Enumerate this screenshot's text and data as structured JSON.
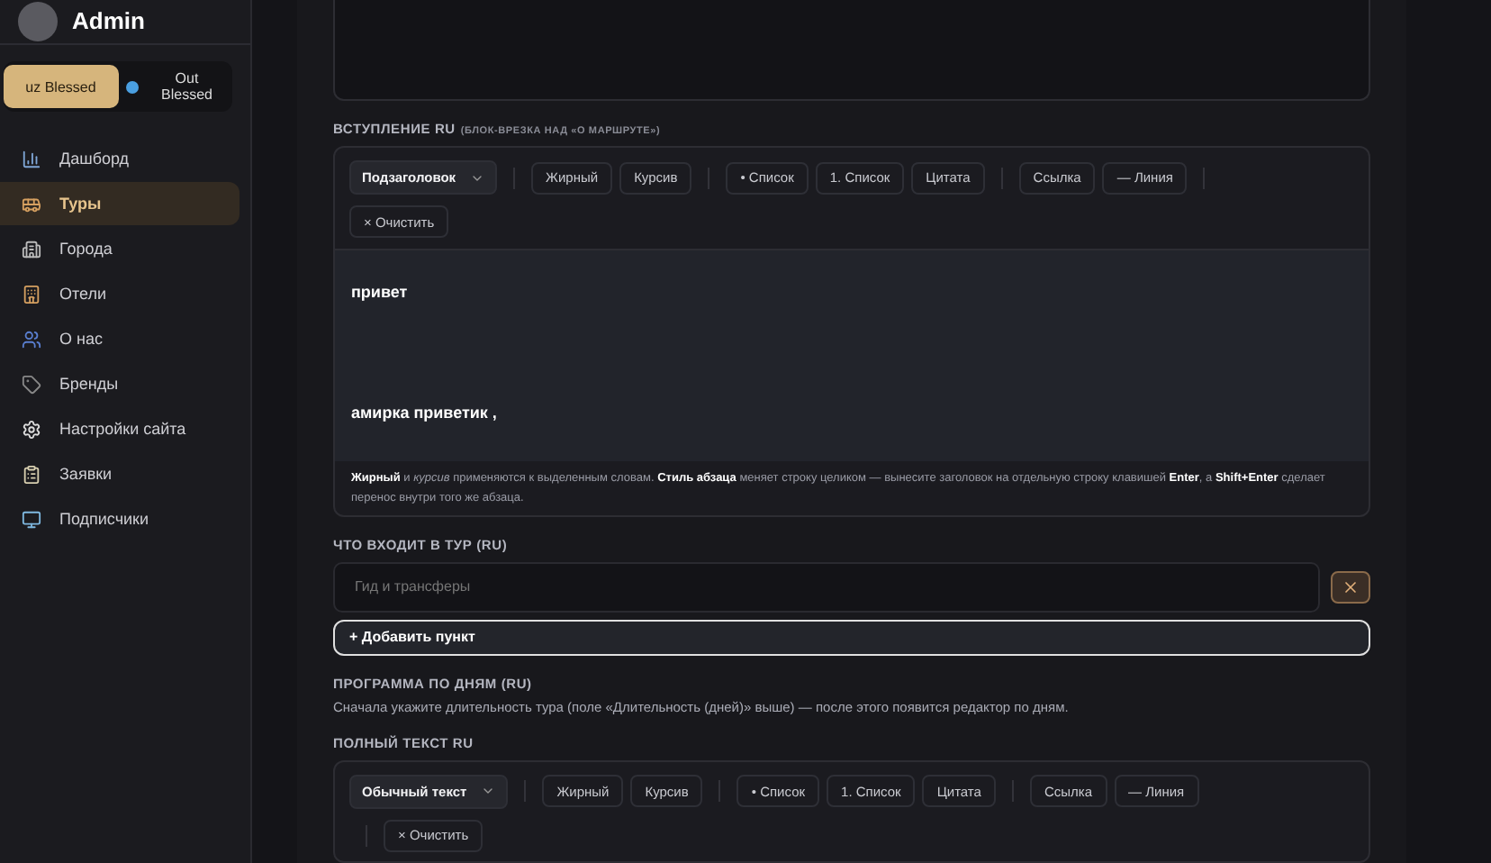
{
  "sidebar": {
    "brand": "Admin",
    "switcher": [
      {
        "label": "uz Blessed",
        "selected": true
      },
      {
        "label": "Out Blessed",
        "selected": false,
        "color": "#4a9fe0"
      }
    ],
    "items": [
      {
        "label": "Дашборд",
        "selected": false
      },
      {
        "label": "Туры",
        "selected": true
      },
      {
        "label": "Города",
        "selected": false
      },
      {
        "label": "Отели",
        "selected": false
      },
      {
        "label": "О нас",
        "selected": false
      },
      {
        "label": "Бренды",
        "selected": false
      },
      {
        "label": "Настройки сайта",
        "selected": false
      },
      {
        "label": "Заявки",
        "selected": false
      },
      {
        "label": "Подписчики",
        "selected": false
      }
    ]
  },
  "intro": {
    "label": "ВСТУПЛЕНИЕ RU",
    "hint": "(БЛОК-ВРЕЗКА НАД «О МАРШРУТЕ»)",
    "toolbar": [
      [
        {
          "kind": "select",
          "label": "Подзаголовок"
        }
      ],
      [
        {
          "kind": "button",
          "label": "Жирный"
        },
        {
          "kind": "button",
          "label": "Курсив"
        }
      ],
      [
        {
          "kind": "button",
          "label": "• Список"
        },
        {
          "kind": "button",
          "label": "1. Список"
        },
        {
          "kind": "button",
          "label": "Цитата"
        }
      ],
      [
        {
          "kind": "button",
          "label": "Ссылка"
        },
        {
          "kind": "button",
          "label": "— Линия"
        }
      ],
      [
        {
          "kind": "button",
          "label": "× Очистить"
        }
      ]
    ],
    "paragraphs": [
      "привет",
      "амирка приветик ,"
    ],
    "help": "**Жирный** и *курсив* применяются к выделенным словам. **Стиль абзаца** меняет строку целиком — вынесите заголовок на отдельную строку клавишей **Enter**, а **Shift+Enter** сделает перенос внутри того же абзаца."
  },
  "includes": {
    "label": "ЧТО ВХОДИТ В ТУР (RU)",
    "items": [
      {
        "placeholder": "Гид и трансферы"
      }
    ],
    "add_button": "+ Добавить пункт"
  },
  "program": {
    "label": "ПРОГРАММА ПО ДНЯМ (RU)",
    "note": "Сначала укажите длительность тура (поле «Длительность (дней)» выше) — после этого появится редактор по дням."
  },
  "full_text": {
    "label": "ПОЛНЫЙ ТЕКСТ RU",
    "toolbar": [
      [
        {
          "kind": "select",
          "label": "Обычный текст"
        }
      ],
      [
        {
          "kind": "button",
          "label": "Жирный"
        },
        {
          "kind": "button",
          "label": "Курсив"
        }
      ],
      [
        {
          "kind": "button",
          "label": "• Список"
        },
        {
          "kind": "button",
          "label": "1. Список"
        },
        {
          "kind": "button",
          "label": "Цитата"
        }
      ],
      [
        {
          "kind": "button",
          "label": "Ссылка"
        },
        {
          "kind": "button",
          "label": "— Линия"
        }
      ],
      [
        {
          "kind": "button",
          "label": "× Очистить"
        }
      ]
    ]
  }
}
